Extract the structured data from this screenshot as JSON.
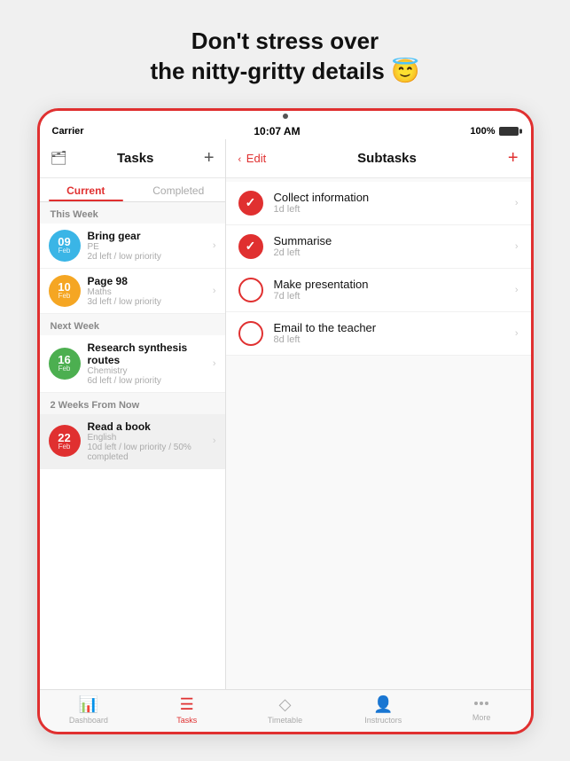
{
  "headline": "Don't stress over\nthe nitty-gritty details 😇",
  "status_bar": {
    "carrier": "Carrier",
    "wifi": "📶",
    "time": "10:07 AM",
    "battery": "100%"
  },
  "tasks_panel": {
    "title": "Tasks",
    "tabs": [
      "Current",
      "Completed"
    ],
    "sections": [
      {
        "label": "This Week",
        "items": [
          {
            "day": "09",
            "month": "Feb",
            "color": "#3ab5e6",
            "title": "Bring gear",
            "subtitle": "PE",
            "detail": "2d left / low priority"
          },
          {
            "day": "10",
            "month": "Feb",
            "color": "#f5a623",
            "title": "Page 98",
            "subtitle": "Maths",
            "detail": "3d left / low priority"
          }
        ]
      },
      {
        "label": "Next Week",
        "items": [
          {
            "day": "16",
            "month": "Feb",
            "color": "#4caf50",
            "title": "Research synthesis routes",
            "subtitle": "Chemistry",
            "detail": "6d left / low priority"
          }
        ]
      },
      {
        "label": "2 Weeks From Now",
        "items": [
          {
            "day": "22",
            "month": "Feb",
            "color": "#e03030",
            "title": "Read a book",
            "subtitle": "English",
            "detail": "10d left / low priority / 50% completed",
            "selected": true
          }
        ]
      }
    ]
  },
  "subtasks_panel": {
    "edit_label": "Edit",
    "title": "Subtasks",
    "items": [
      {
        "name": "Collect information",
        "time": "1d left",
        "checked": true
      },
      {
        "name": "Summarise",
        "time": "2d left",
        "checked": true
      },
      {
        "name": "Make presentation",
        "time": "7d left",
        "checked": false
      },
      {
        "name": "Email to the teacher",
        "time": "8d left",
        "checked": false
      }
    ]
  },
  "tab_bar": {
    "items": [
      "Dashboard",
      "Tasks",
      "Timetable",
      "Instructors",
      "More"
    ]
  }
}
